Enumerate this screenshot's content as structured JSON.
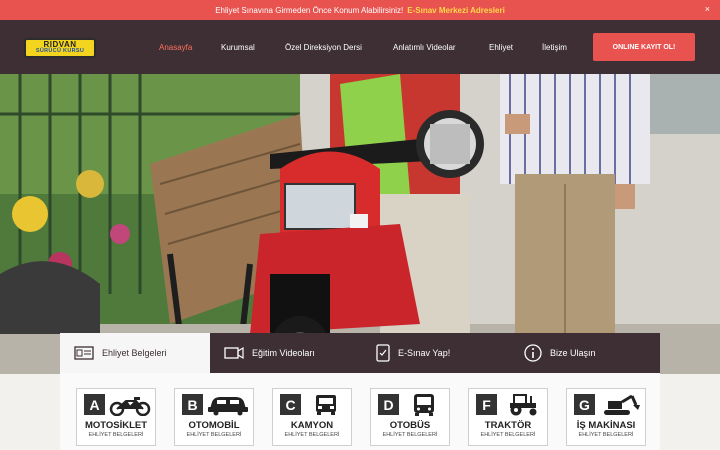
{
  "announcement": {
    "text": "Ehliyet Sınavına Girmeden Önce Konum Alabilirsiniz!",
    "link": "E-Sınav Merkezi Adresleri",
    "close": "×"
  },
  "logo": {
    "line1": "RIDVAN",
    "line2": "SÜRÜCÜ KURSU"
  },
  "nav": {
    "items": [
      {
        "label": "Anasayfa"
      },
      {
        "label": "Kurumsal"
      },
      {
        "label": "Özel Direksiyon Dersi"
      },
      {
        "label": "Anlatımlı Videolar"
      },
      {
        "label": "Ehliyet"
      },
      {
        "label": "İletişim"
      }
    ],
    "cta": "ONLINE KAYIT OL!"
  },
  "tabs": [
    {
      "label": "Ehliyet Belgeleri",
      "icon": "license-card-icon"
    },
    {
      "label": "Eğitim Videoları",
      "icon": "video-camera-icon"
    },
    {
      "label": "E-Sınav Yap!",
      "icon": "phone-exam-icon"
    },
    {
      "label": "Bize Ulaşın",
      "icon": "info-icon"
    }
  ],
  "cards": [
    {
      "letter": "A",
      "title": "MOTOSİKLET",
      "sub": "EHLİYET BELGELERİ",
      "icon": "motorcycle-icon"
    },
    {
      "letter": "B",
      "title": "OTOMOBİL",
      "sub": "EHLİYET BELGELERİ",
      "icon": "car-icon"
    },
    {
      "letter": "C",
      "title": "KAMYON",
      "sub": "EHLİYET BELGELERİ",
      "icon": "truck-icon"
    },
    {
      "letter": "D",
      "title": "OTOBÜS",
      "sub": "EHLİYET BELGELERİ",
      "icon": "bus-icon"
    },
    {
      "letter": "F",
      "title": "TRAKTÖR",
      "sub": "EHLİYET BELGELERİ",
      "icon": "tractor-icon"
    },
    {
      "letter": "G",
      "title": "İŞ MAKİNASI",
      "sub": "EHLİYET BELGELERİ",
      "icon": "excavator-icon"
    }
  ],
  "colors": {
    "primary": "#e8534f",
    "dark": "#3d2f33",
    "accent": "#ffd84a",
    "logo": "#f3d51f"
  }
}
